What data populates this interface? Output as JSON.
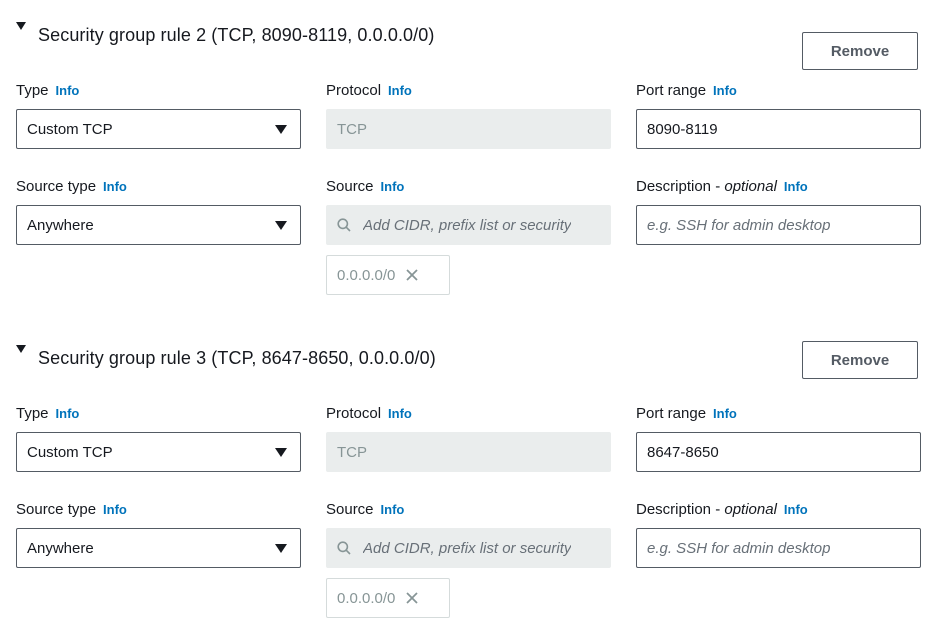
{
  "rules": [
    {
      "title": "Security group rule 2 (TCP, 8090-8119, 0.0.0.0/0)",
      "remove_label": "Remove",
      "type_label": "Type",
      "type_value": "Custom TCP",
      "protocol_label": "Protocol",
      "protocol_value": "TCP",
      "port_label": "Port range",
      "port_value": "8090-8119",
      "source_type_label": "Source type",
      "source_type_value": "Anywhere",
      "source_label": "Source",
      "source_placeholder": "Add CIDR, prefix list or security",
      "source_token": "0.0.0.0/0",
      "desc_label": "Description - ",
      "desc_optional": "optional",
      "desc_placeholder": "e.g. SSH for admin desktop",
      "info": "Info"
    },
    {
      "title": "Security group rule 3 (TCP, 8647-8650, 0.0.0.0/0)",
      "remove_label": "Remove",
      "type_label": "Type",
      "type_value": "Custom TCP",
      "protocol_label": "Protocol",
      "protocol_value": "TCP",
      "port_label": "Port range",
      "port_value": "8647-8650",
      "source_type_label": "Source type",
      "source_type_value": "Anywhere",
      "source_label": "Source",
      "source_placeholder": "Add CIDR, prefix list or security",
      "source_token": "0.0.0.0/0",
      "desc_label": "Description - ",
      "desc_optional": "optional",
      "desc_placeholder": "e.g. SSH for admin desktop",
      "info": "Info"
    }
  ]
}
